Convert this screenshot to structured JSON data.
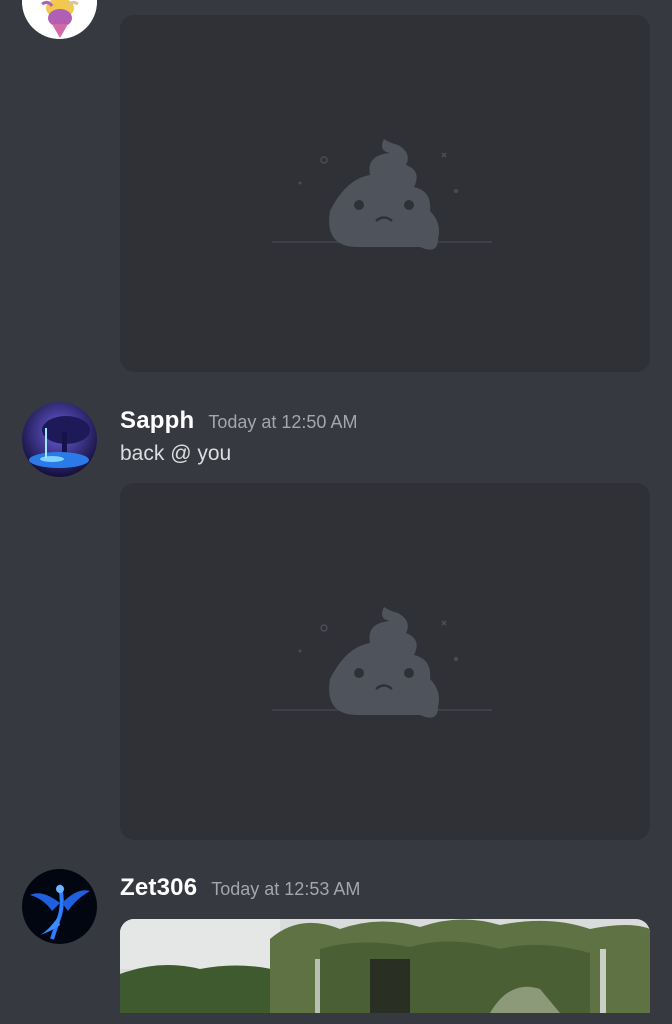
{
  "colors": {
    "background": "#36393f",
    "embed_background": "#2f3136",
    "username": "#ffffff",
    "timestamp": "#a3a6aa",
    "text": "#dcddde",
    "placeholder_icon": "#4f545c"
  },
  "messages": [
    {
      "avatar_icon": "partial-avatar-icon",
      "attachment": {
        "type": "failed-image",
        "icon": "sad-poop-placeholder-icon"
      }
    },
    {
      "username": "Sapph",
      "timestamp": "Today at 12:50 AM",
      "content": "back @ you",
      "avatar_icon": "night-forest-avatar-icon",
      "attachment": {
        "type": "failed-image",
        "icon": "sad-poop-placeholder-icon"
      }
    },
    {
      "username": "Zet306",
      "timestamp": "Today at 12:53 AM",
      "avatar_icon": "blue-phoenix-avatar-icon",
      "attachment": {
        "type": "image",
        "icon": "trees-photo-icon"
      }
    }
  ]
}
